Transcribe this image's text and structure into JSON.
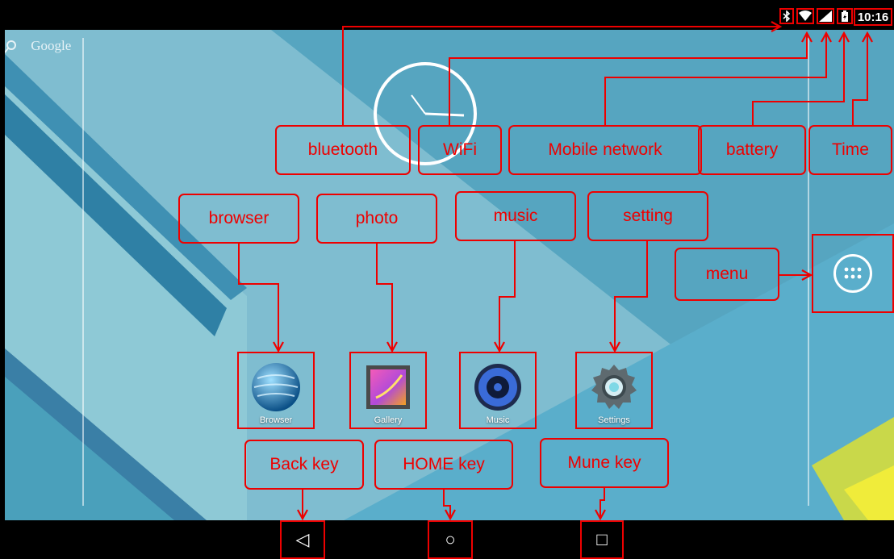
{
  "status_bar": {
    "icons": {
      "bluetooth": "bluetooth-icon",
      "wifi": "wifi-icon",
      "mobile_network": "signal-icon",
      "battery": "battery-icon"
    },
    "time": "10:16"
  },
  "search": {
    "label": "Google"
  },
  "apps": [
    {
      "name": "browser",
      "label": "Browser"
    },
    {
      "name": "gallery",
      "label": "Gallery"
    },
    {
      "name": "music",
      "label": "Music"
    },
    {
      "name": "settings",
      "label": "Settings"
    }
  ],
  "annotations": {
    "bluetooth": "bluetooth",
    "wifi": "WiFi",
    "mobile_network": "Mobile network",
    "battery": "battery",
    "time": "Time",
    "browser": "browser",
    "photo": "photo",
    "music": "music",
    "setting": "setting",
    "menu": "menu",
    "back_key": "Back key",
    "home_key": "HOME key",
    "menu_key": "Mune key"
  },
  "nav": {
    "back": "◁",
    "home": "○",
    "recents": "□"
  },
  "colors": {
    "annotation": "#e00000",
    "wallpaper": "#4fa1bd",
    "bars": "#000000"
  }
}
